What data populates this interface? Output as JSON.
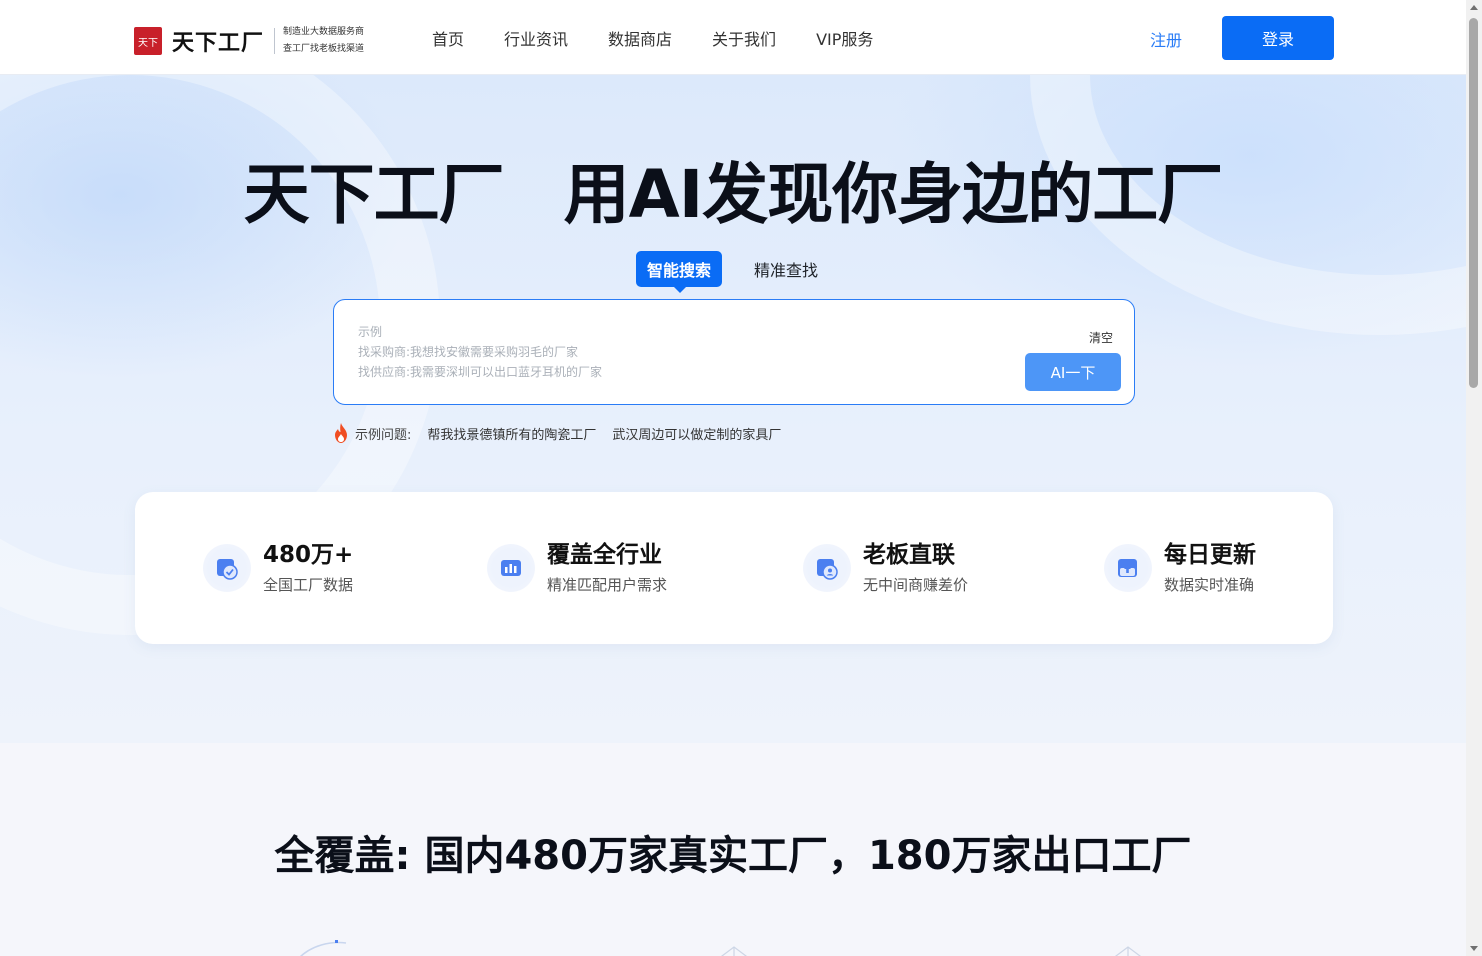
{
  "header": {
    "logo_mark": "天下",
    "logo_name": "天下工厂",
    "tagline_1": "制造业大数据服务商",
    "tagline_2": "查工厂找老板找渠道",
    "nav": [
      "首页",
      "行业资讯",
      "数据商店",
      "关于我们",
      "VIP服务"
    ],
    "register": "注册",
    "login": "登录"
  },
  "hero": {
    "title_left": "天下工厂",
    "title_right": "用AI发现你身边的工厂",
    "tabs": {
      "active": "智能搜索",
      "other": "精准查找"
    },
    "search": {
      "label": "示例",
      "example_1": "找采购商:我想找安徽需要采购羽毛的厂家",
      "example_2": "找供应商:我需要深圳可以出口蓝牙耳机的厂家",
      "clear": "清空",
      "submit": "AI一下"
    },
    "examples": {
      "label": "示例问题:",
      "items": [
        "帮我找景德镇所有的陶瓷工厂",
        "武汉周边可以做定制的家具厂"
      ]
    }
  },
  "stats": [
    {
      "title": "480万+",
      "sub": "全国工厂数据",
      "icon": "check-chart-icon"
    },
    {
      "title": "覆盖全行业",
      "sub": "精准匹配用户需求",
      "icon": "bar-chart-icon"
    },
    {
      "title": "老板直联",
      "sub": "无中间商赚差价",
      "icon": "user-contact-icon"
    },
    {
      "title": "每日更新",
      "sub": "数据实时准确",
      "icon": "upload-icon"
    }
  ],
  "lower": {
    "title": "全覆盖: 国内480万家真实工厂，180万家出口工厂"
  },
  "colors": {
    "primary": "#0a6cf5",
    "ai_button": "#4d96f7",
    "link": "#2a7cf6"
  }
}
